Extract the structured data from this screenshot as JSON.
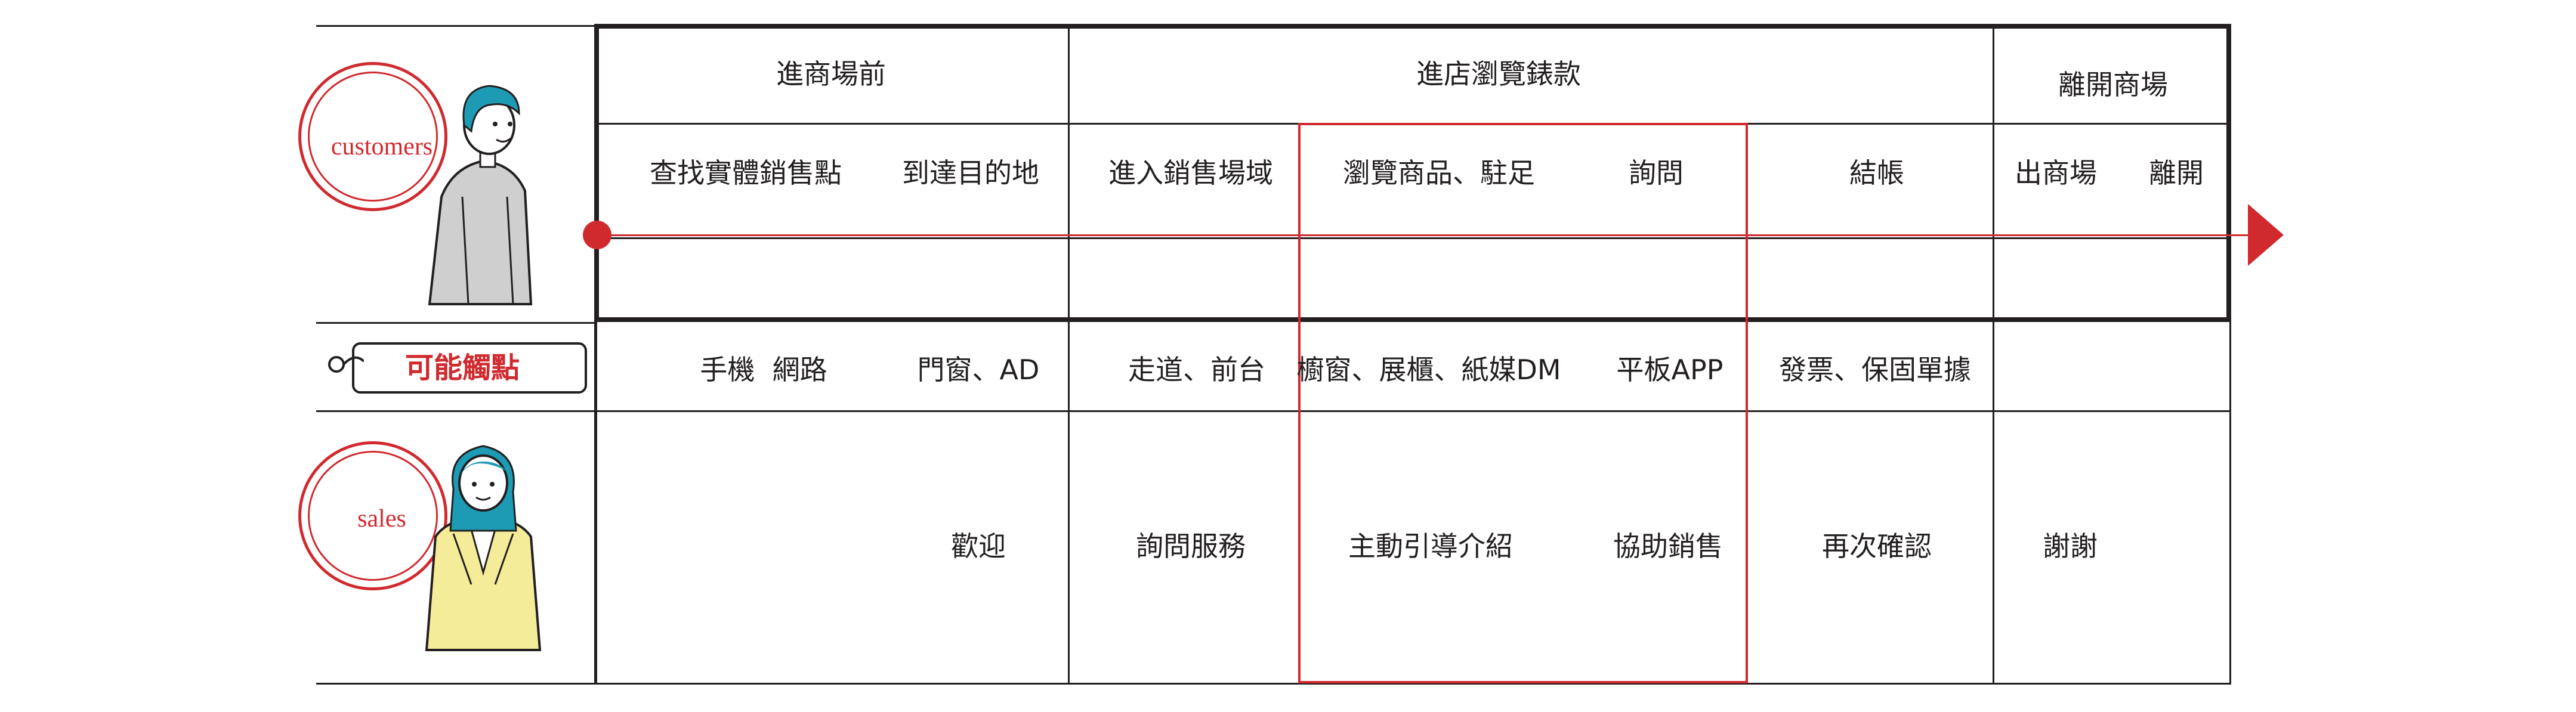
{
  "roles": {
    "customers": "customers",
    "touchpoints": "可能觸點",
    "sales": "sales"
  },
  "stages": {
    "before": "進商場前",
    "browse": "進店瀏覽錶款",
    "leave": "離開商場"
  },
  "customer_steps": {
    "find": "查找實體銷售點",
    "arrive": "到達目的地",
    "enter": "進入銷售場域",
    "browse": "瀏覽商品、駐足",
    "ask": "詢問",
    "checkout": "結帳",
    "exit": "出商場",
    "leave": "離開"
  },
  "touchpoints": {
    "phone_web": "手機  網路",
    "door_ad": "門窗、AD",
    "aisle": "走道、前台",
    "display": "櫥窗、展櫃、紙媒DM",
    "tablet": "平板APP",
    "invoice": "發票、保固單據"
  },
  "sales_steps": {
    "welcome": "歡迎",
    "service": "詢問服務",
    "guide": "主動引導介紹",
    "assist": "協助銷售",
    "confirm": "再次確認",
    "thanks": "謝謝"
  },
  "colors": {
    "accent_red": "#d02a2f",
    "line": "#231f20",
    "hair_teal": "#1d9bb5",
    "hoodie_gray": "#cfcfcf",
    "jacket_yellow": "#f5ec9a"
  }
}
